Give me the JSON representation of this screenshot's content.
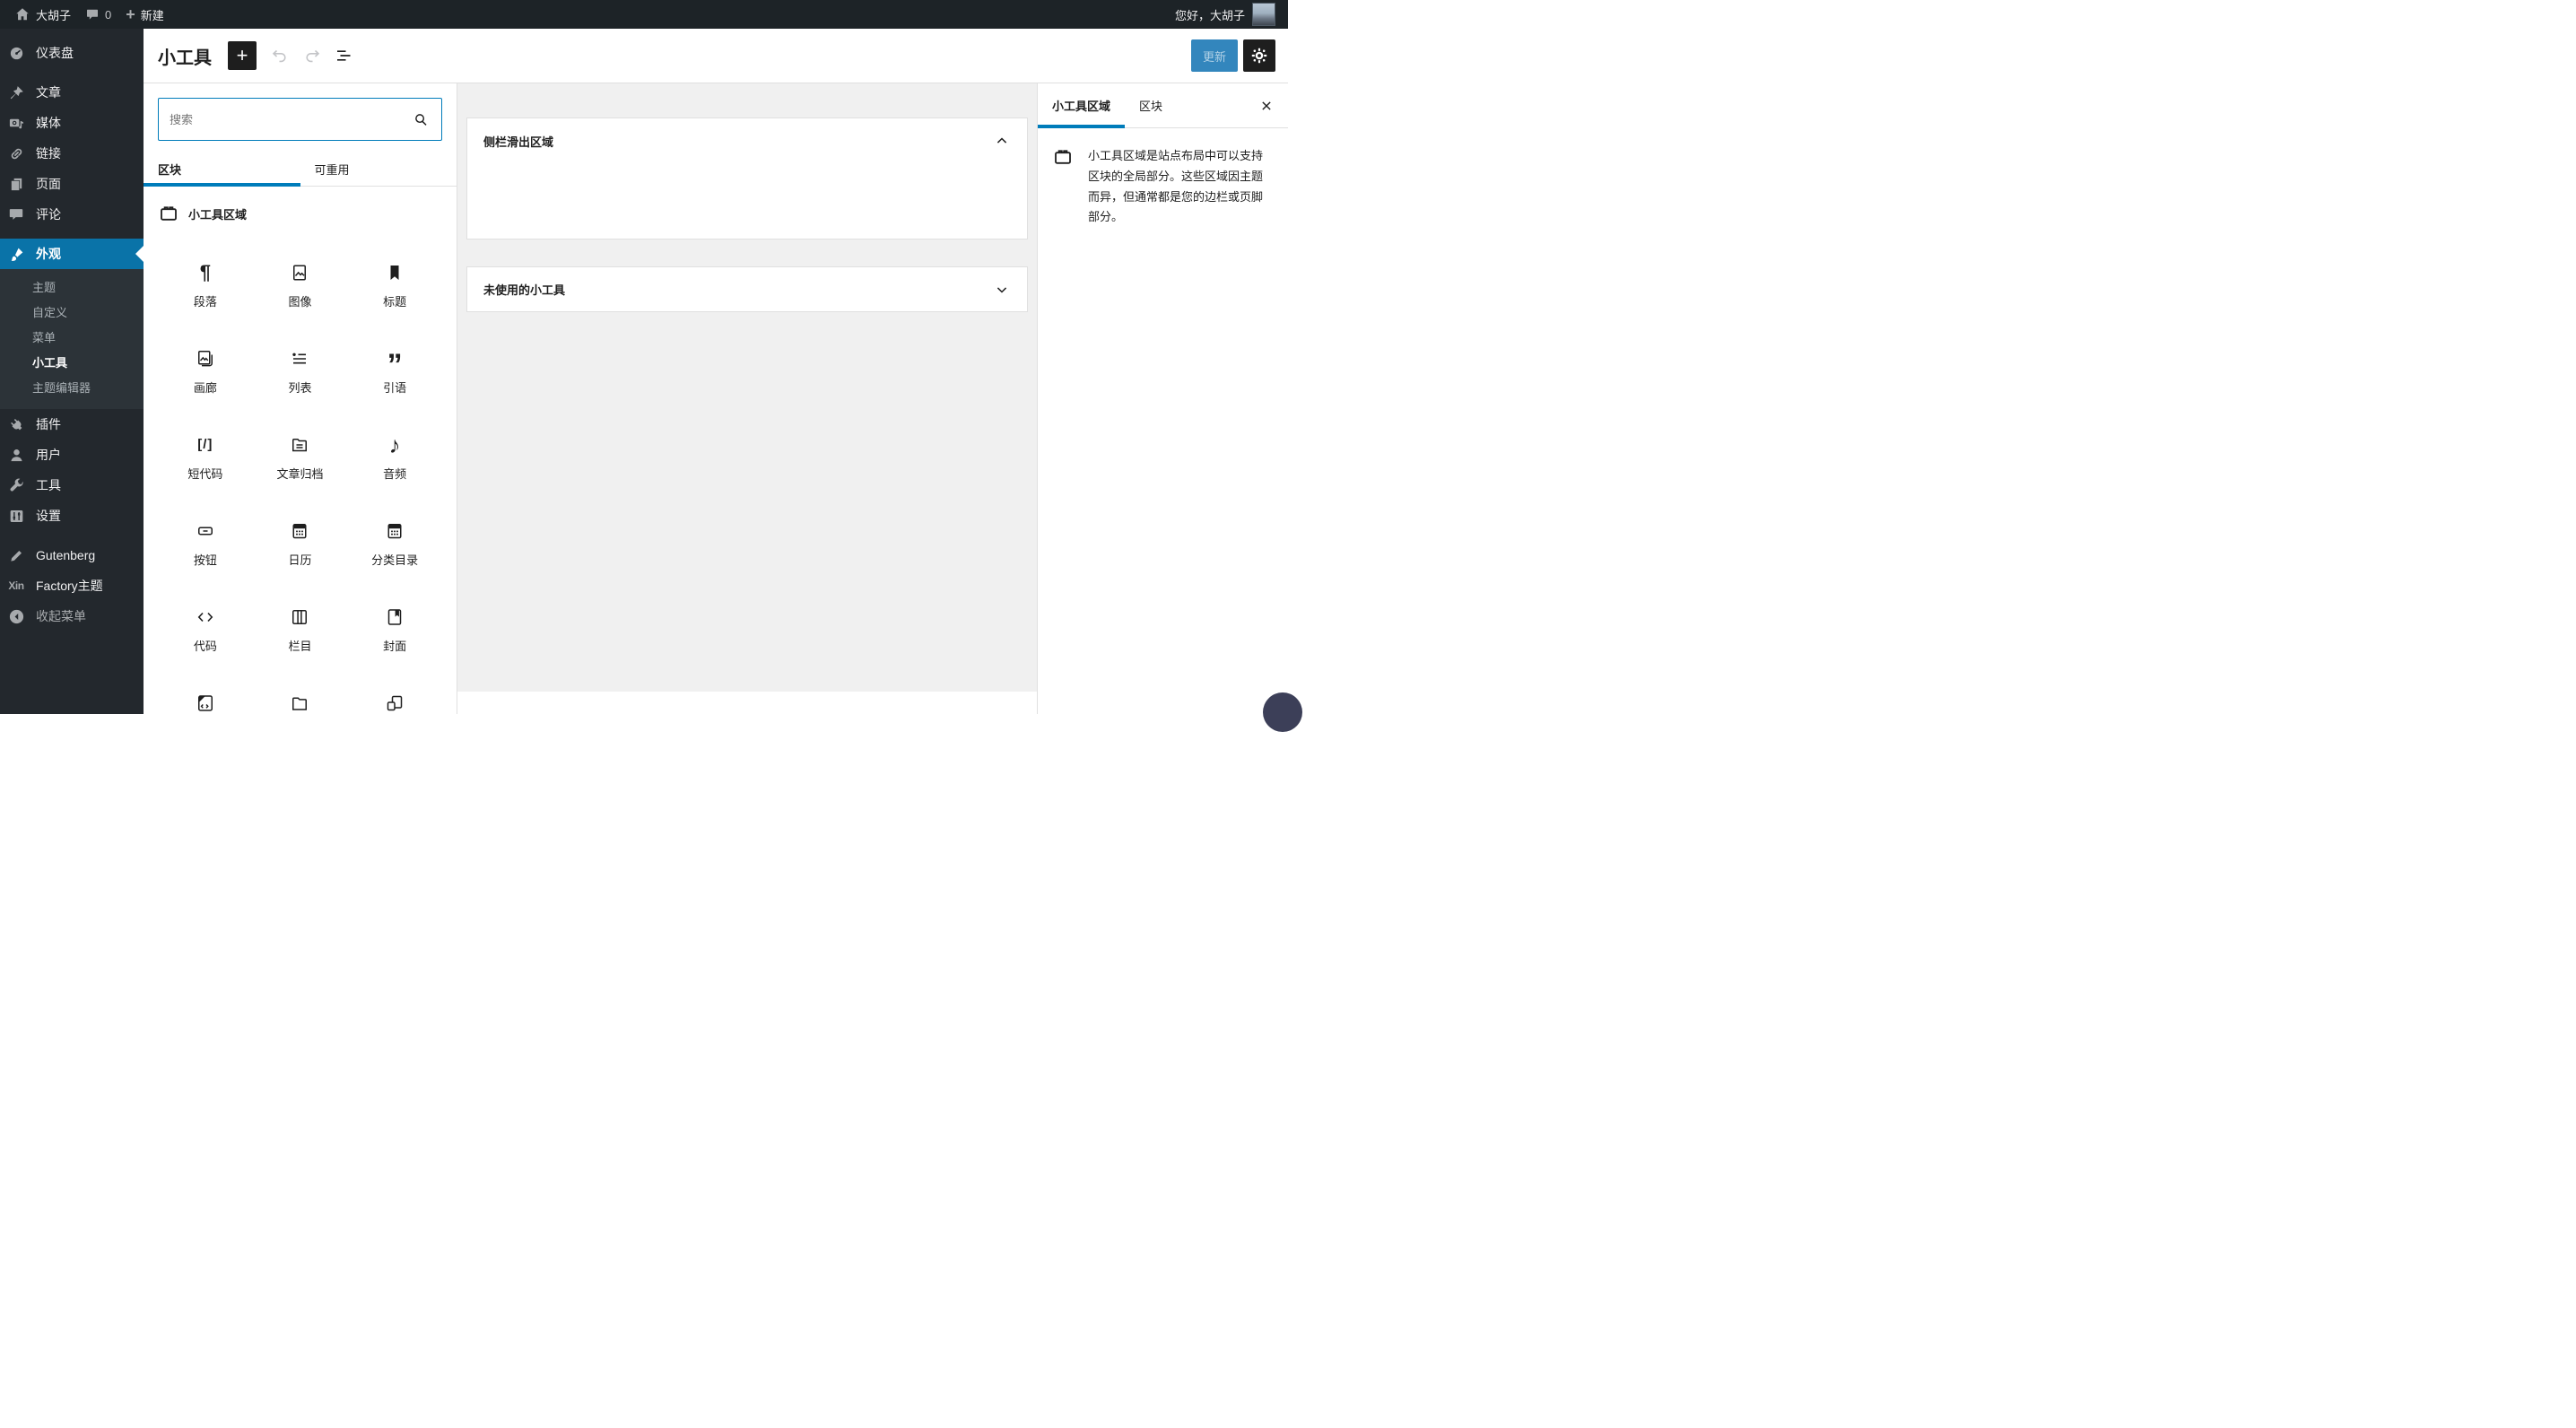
{
  "colors": {
    "accent": "#007cba",
    "menu_active": "#0a73a8",
    "admin_bar_bg": "#1d2327",
    "menu_bg": "#23282d",
    "submenu_bg": "#2c3338",
    "canvas_bg": "#f0f0f0",
    "border": "#e0e0e0",
    "text": "#1e1e1e"
  },
  "admin_bar": {
    "site_name": "大胡子",
    "comment_count": "0",
    "new_label": "新建",
    "greeting": "您好，大胡子"
  },
  "sidebar": {
    "items": [
      "仪表盘",
      "文章",
      "媒体",
      "链接",
      "页面",
      "评论",
      "外观",
      "插件",
      "用户",
      "工具",
      "设置",
      "Gutenberg",
      "Factory主题",
      "收起菜单"
    ],
    "submenu": [
      "主题",
      "自定义",
      "菜单",
      "小工具",
      "主题编辑器"
    ],
    "current_submenu": "小工具"
  },
  "header": {
    "title": "小工具",
    "update_label": "更新"
  },
  "inserter": {
    "search_placeholder": "搜索",
    "tabs": [
      "区块",
      "可重用"
    ],
    "section_title": "小工具区域",
    "blocks": [
      {
        "label": "段落",
        "icon": "paragraph-icon"
      },
      {
        "label": "图像",
        "icon": "image-icon"
      },
      {
        "label": "标题",
        "icon": "heading-icon"
      },
      {
        "label": "画廊",
        "icon": "gallery-icon"
      },
      {
        "label": "列表",
        "icon": "list-icon"
      },
      {
        "label": "引语",
        "icon": "quote-icon"
      },
      {
        "label": "短代码",
        "icon": "shortcode-icon"
      },
      {
        "label": "文章归档",
        "icon": "archives-icon"
      },
      {
        "label": "音频",
        "icon": "audio-icon"
      },
      {
        "label": "按钮",
        "icon": "button-icon"
      },
      {
        "label": "日历",
        "icon": "calendar-icon"
      },
      {
        "label": "分类目录",
        "icon": "categories-icon"
      },
      {
        "label": "代码",
        "icon": "code-icon"
      },
      {
        "label": "栏目",
        "icon": "columns-icon"
      },
      {
        "label": "封面",
        "icon": "cover-icon"
      },
      {
        "label": "",
        "icon": "custom-html-icon"
      },
      {
        "label": "",
        "icon": "file-icon"
      },
      {
        "label": "",
        "icon": "group-icon"
      }
    ]
  },
  "canvas": {
    "panels": [
      {
        "title": "侧栏滑出区域",
        "state": "expanded"
      },
      {
        "title": "未使用的小工具",
        "state": "collapsed"
      }
    ]
  },
  "right_sidebar": {
    "tabs": [
      "小工具区域",
      "区块"
    ],
    "description": "小工具区域是站点布局中可以支持区块的全局部分。这些区域因主题而异，但通常都是您的边栏或页脚部分。"
  }
}
